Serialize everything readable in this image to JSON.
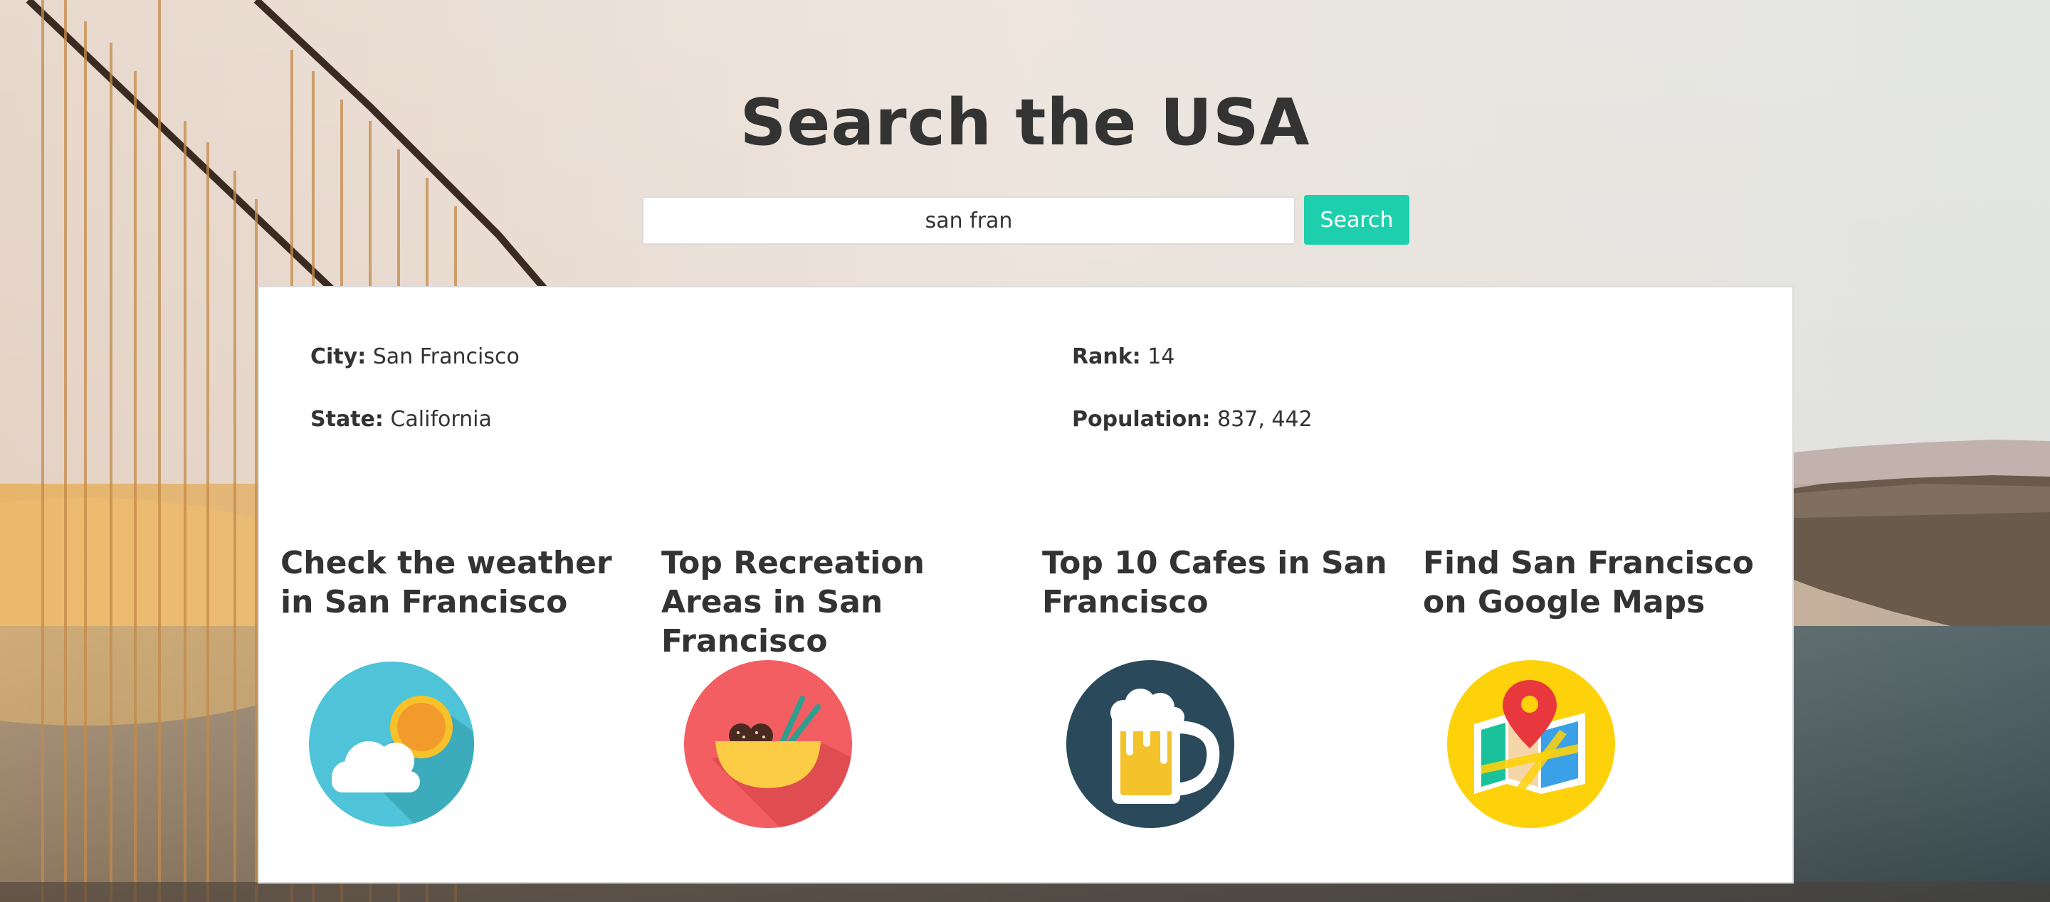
{
  "header": {
    "title": "Search the USA"
  },
  "search": {
    "value": "san fran",
    "button_label": "Search"
  },
  "result": {
    "city": {
      "label": "City:",
      "value": "San Francisco"
    },
    "state": {
      "label": "State:",
      "value": "California"
    },
    "rank": {
      "label": "Rank:",
      "value": "14"
    },
    "population": {
      "label": "Population:",
      "value": "837, 442"
    }
  },
  "links": [
    {
      "title": "Check the weather in San Francisco",
      "icon": "weather-icon"
    },
    {
      "title": "Top Recreation Areas in San Francisco",
      "icon": "recreation-bowl-icon"
    },
    {
      "title": "Top 10 Cafes in San Francisco",
      "icon": "beer-mug-icon"
    },
    {
      "title": "Find San Francisco on Google Maps",
      "icon": "map-pin-icon"
    }
  ],
  "colors": {
    "accent": "#1ecfad",
    "weather_bg": "#4fc4d9",
    "recreation_bg": "#f25e62",
    "cafe_bg": "#2a4a5c",
    "map_bg": "#fdd20a"
  }
}
